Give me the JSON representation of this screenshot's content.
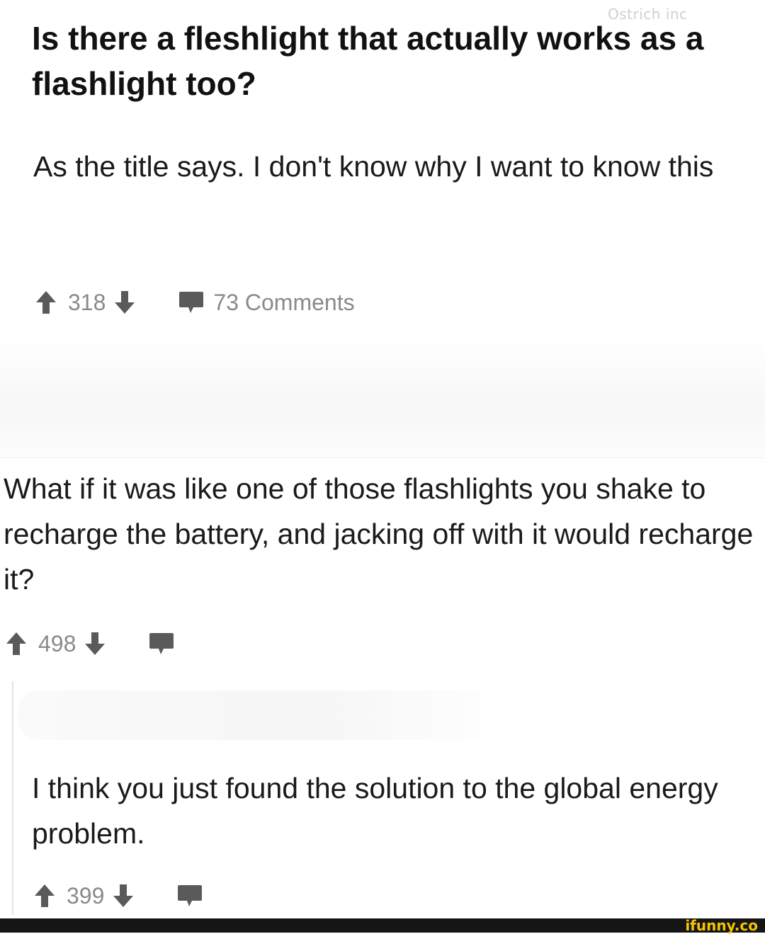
{
  "watermark": "Ostrich inc",
  "post": {
    "title": "Is there a fleshlight that actually works as a flashlight too?",
    "body": "As the title says. I don't know why I want to know this",
    "score": "318",
    "comments_label": "73 Comments"
  },
  "comments": [
    {
      "text": "What if it was like one of those flashlights you shake to recharge the battery, and jacking off with it would recharge it?",
      "score": "498"
    },
    {
      "text": "I think you just found the solution to the global energy problem.",
      "score": "399"
    }
  ],
  "footer": {
    "logo": "ifunny.co"
  },
  "icons": {
    "upvote": "upvote-arrow-icon",
    "downvote": "downvote-arrow-icon",
    "comment": "comment-bubble-icon"
  },
  "colors": {
    "text": "#1a1a1a",
    "meta": "#8a8a8a",
    "icon": "#5a5a5a",
    "footer_bg": "#151515",
    "logo": "#f5c400"
  }
}
